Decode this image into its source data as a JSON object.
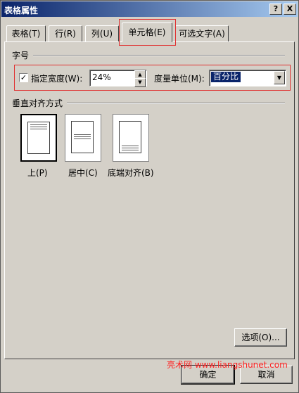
{
  "window": {
    "title": "表格属性",
    "help_label": "?",
    "close_label": "X"
  },
  "tabs": [
    {
      "label": "表格(T)"
    },
    {
      "label": "行(R)"
    },
    {
      "label": "列(U)"
    },
    {
      "label": "单元格(E)",
      "active": true
    },
    {
      "label": "可选文字(A)"
    }
  ],
  "size_group": {
    "label": "字号",
    "preferred_width_checked": true,
    "checkmark": "✓",
    "preferred_width_label": "指定宽度(W):",
    "width_value": "24%",
    "measure_label": "度量单位(M):",
    "measure_value": "百分比"
  },
  "valign_group": {
    "label": "垂直对齐方式",
    "options": [
      {
        "label": "上(P)",
        "selected": true
      },
      {
        "label": "居中(C)",
        "selected": false
      },
      {
        "label": "底端对齐(B)",
        "selected": false
      }
    ]
  },
  "options_button": "选项(O)...",
  "ok_button": "确定",
  "cancel_button": "取消",
  "watermark": "亮术网 www.liangshunet.com",
  "colors": {
    "highlight_box": "#e03030",
    "selection": "#0a246a",
    "watermark": "#ff2020"
  }
}
